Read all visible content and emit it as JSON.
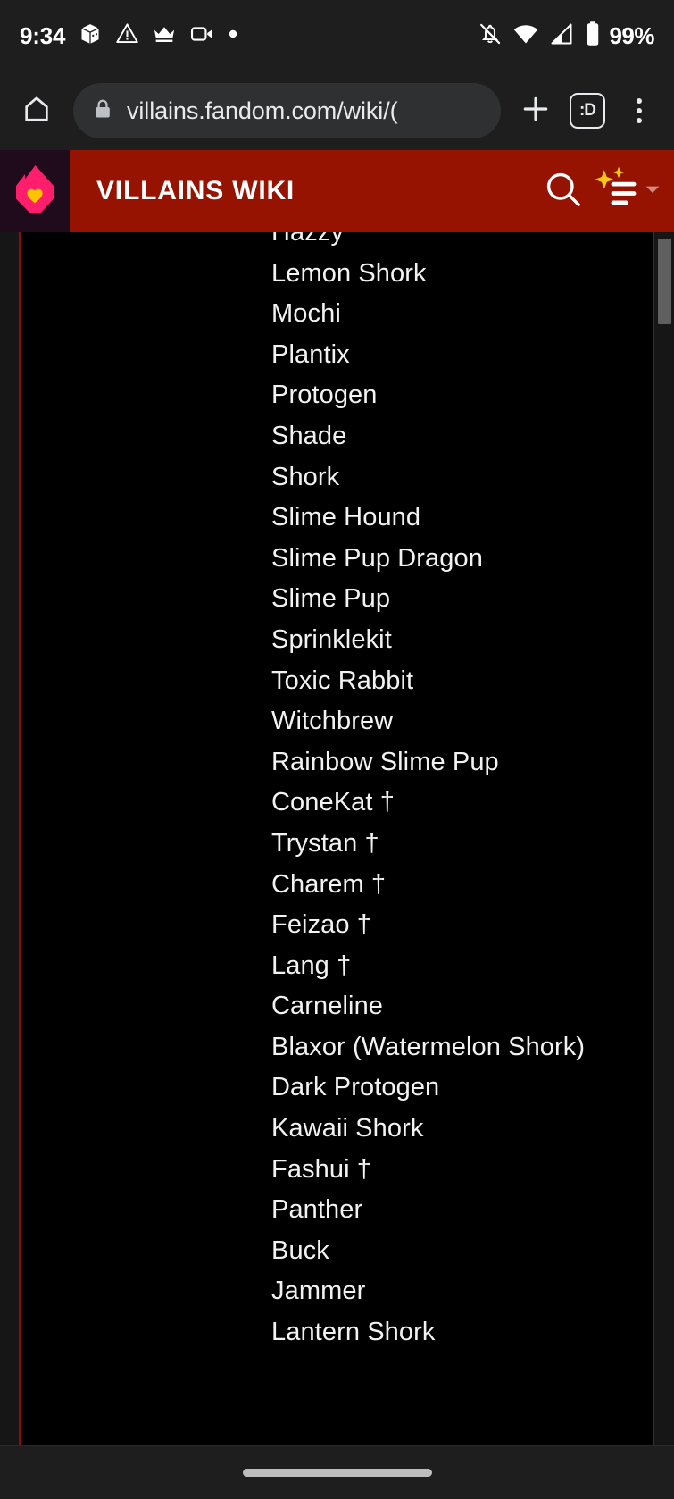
{
  "status_bar": {
    "clock": "9:34",
    "battery_percent": "99%",
    "left_icons": [
      "package-icon",
      "warning-triangle-icon",
      "crown-icon",
      "video-camera-icon",
      "recording-dot-icon"
    ],
    "right_icons": [
      "notifications-off-icon",
      "wifi-icon",
      "cellular-signal-icon",
      "battery-icon"
    ]
  },
  "browser": {
    "home_label": "home-icon",
    "url": "villains.fandom.com/wiki/(",
    "lock_label": "lock-icon",
    "new_tab_label": "+",
    "tab_count": ":D",
    "menu_label": "kebab-menu-icon"
  },
  "wiki_header": {
    "brand": "fandom-flame-logo",
    "title": "VILLAINS WIKI",
    "search_label": "search-icon",
    "nav_label": "hamburger-sparkle-icon",
    "dropdown_label": "chevron-down-icon",
    "bar_color": "#951300",
    "logo_bg_color": "#200b1d",
    "flame_color": "#ff1e6b",
    "heart_color": "#ffc400",
    "sparkle_color": "#ffc91b"
  },
  "content": {
    "border_color": "#8b0c17",
    "background_color": "#000000",
    "text_color": "#f2f2f2",
    "items": [
      "Hazzy",
      "Lemon Shork",
      "Mochi",
      "Plantix",
      "Protogen",
      "Shade",
      "Shork",
      "Slime Hound",
      "Slime Pup Dragon",
      "Slime Pup",
      "Sprinklekit",
      "Toxic Rabbit",
      "Witchbrew",
      "Rainbow Slime Pup",
      "ConeKat †",
      "Trystan †",
      "Charem †",
      "Feizao †",
      "Lang †",
      "Carneline",
      "Blaxor (Watermelon Shork)",
      "Dark Protogen",
      "Kawaii Shork",
      "Fashui †",
      "Panther",
      "Buck",
      "Jammer",
      "Lantern Shork"
    ]
  },
  "scrollbar": {
    "thumb_label": "scrollbar-thumb"
  },
  "nav_bar": {
    "gesture_pill": "gesture-navigation-pill"
  }
}
